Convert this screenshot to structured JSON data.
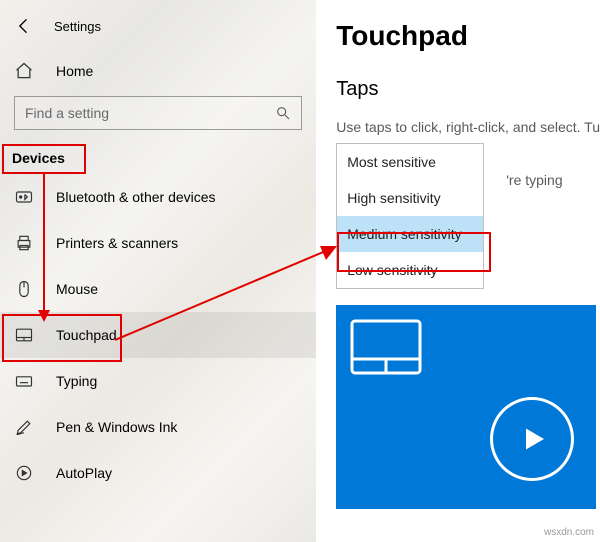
{
  "header": {
    "settings_title": "Settings"
  },
  "home_label": "Home",
  "search": {
    "placeholder": "Find a setting"
  },
  "section_header": "Devices",
  "nav": [
    {
      "label": "Bluetooth & other devices",
      "icon": "bt"
    },
    {
      "label": "Printers & scanners",
      "icon": "printer"
    },
    {
      "label": "Mouse",
      "icon": "mouse"
    },
    {
      "label": "Touchpad",
      "icon": "touchpad",
      "selected": true
    },
    {
      "label": "Typing",
      "icon": "keyboard"
    },
    {
      "label": "Pen & Windows Ink",
      "icon": "pen"
    },
    {
      "label": "AutoPlay",
      "icon": "autoplay"
    }
  ],
  "main": {
    "title": "Touchpad",
    "subtitle": "Taps",
    "help_line1": "Use taps to click, right-click, and select. Tu",
    "help_line2": "'re typing",
    "dropdown": {
      "options": [
        "Most sensitive",
        "High sensitivity",
        "Medium sensitivity",
        "Low sensitivity"
      ],
      "selected_index": 2
    }
  },
  "watermark": "wsxdn.com"
}
